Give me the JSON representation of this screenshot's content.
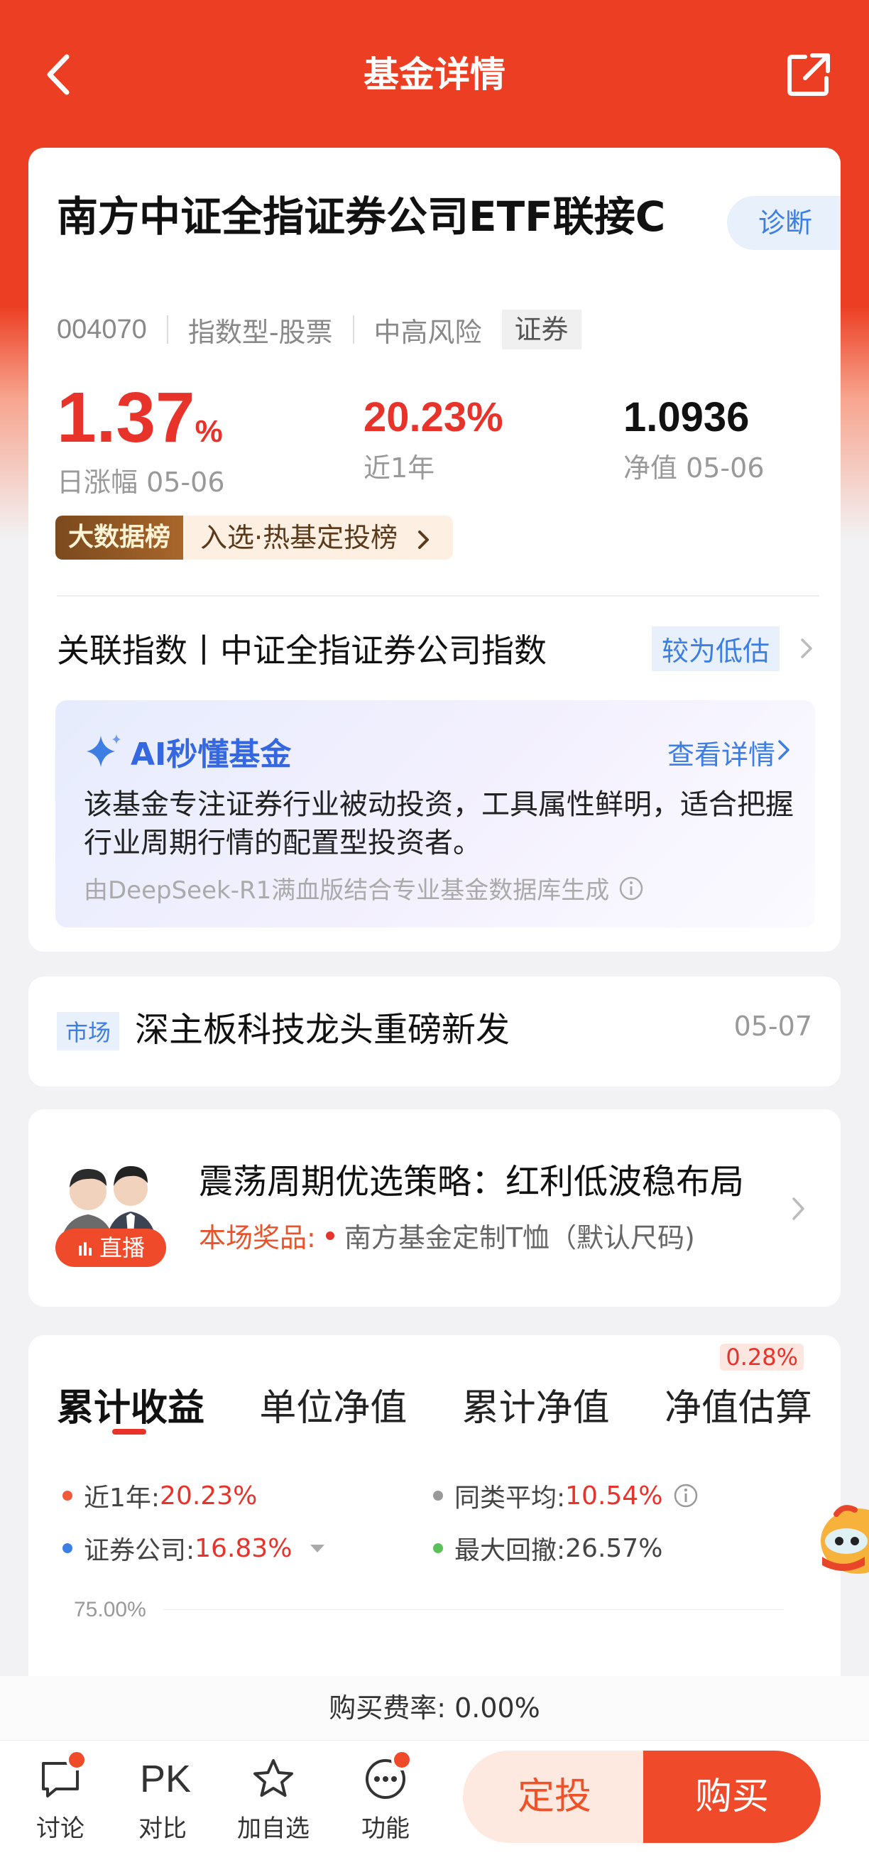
{
  "header": {
    "title": "基金详情"
  },
  "fund": {
    "name": "南方中证全指证券公司ETF联接C",
    "diagnose_label": "诊断",
    "code": "004070",
    "type": "指数型-股票",
    "risk": "中高风险",
    "sector_tag": "证券",
    "daily_change_value": "1.37",
    "daily_change_unit": "%",
    "daily_change_label": "日涨幅 05-06",
    "year_return_value": "20.23%",
    "year_return_label": "近1年",
    "nav_value": "1.0936",
    "nav_label": "净值 05-06",
    "rank_badge": "大数据榜",
    "rank_text": "入选·热基定投榜",
    "index_text": "关联指数丨中证全指证券公司指数",
    "index_valuation": "较为低估"
  },
  "ai": {
    "title": "AI秒懂基金",
    "more": "查看详情",
    "body": "该基金专注证券行业被动投资，工具属性鲜明，适合把握行业周期行情的配置型投资者。",
    "footnote": "由DeepSeek-R1满血版结合专业基金数据库生成"
  },
  "news": {
    "tag": "市场",
    "title": "深主板科技龙头重磅新发",
    "date": "05-07"
  },
  "live": {
    "badge": "直播",
    "title": "震荡周期优选策略：红利低波稳布局",
    "prize_label": "本场奖品:",
    "prize_value": "南方基金定制T恤（默认尺码)"
  },
  "chart_tabs": {
    "tabs": [
      "累计收益",
      "单位净值",
      "累计净值",
      "净值估算"
    ],
    "active": 0,
    "estimate_badge": "0.28%"
  },
  "legend": {
    "item1_label": "近1年:",
    "item1_value": "20.23%",
    "item1_color": "#ef5b3a",
    "item2_label": "同类平均:",
    "item2_value": "10.54%",
    "item2_color": "#999999",
    "item3_label": "证券公司:",
    "item3_value": "16.83%",
    "item3_color": "#3d7ee4",
    "item4_label": "最大回撤:",
    "item4_value": "26.57%",
    "item4_color": "#5ac05a"
  },
  "chart": {
    "y_top_label": "75.00%"
  },
  "fee": {
    "text": "购买费率: 0.00%"
  },
  "bottom_bar": {
    "discuss": "讨论",
    "compare_glyph": "PK",
    "compare": "对比",
    "watch": "加自选",
    "functions": "功能",
    "sip": "定投",
    "buy": "购买"
  }
}
